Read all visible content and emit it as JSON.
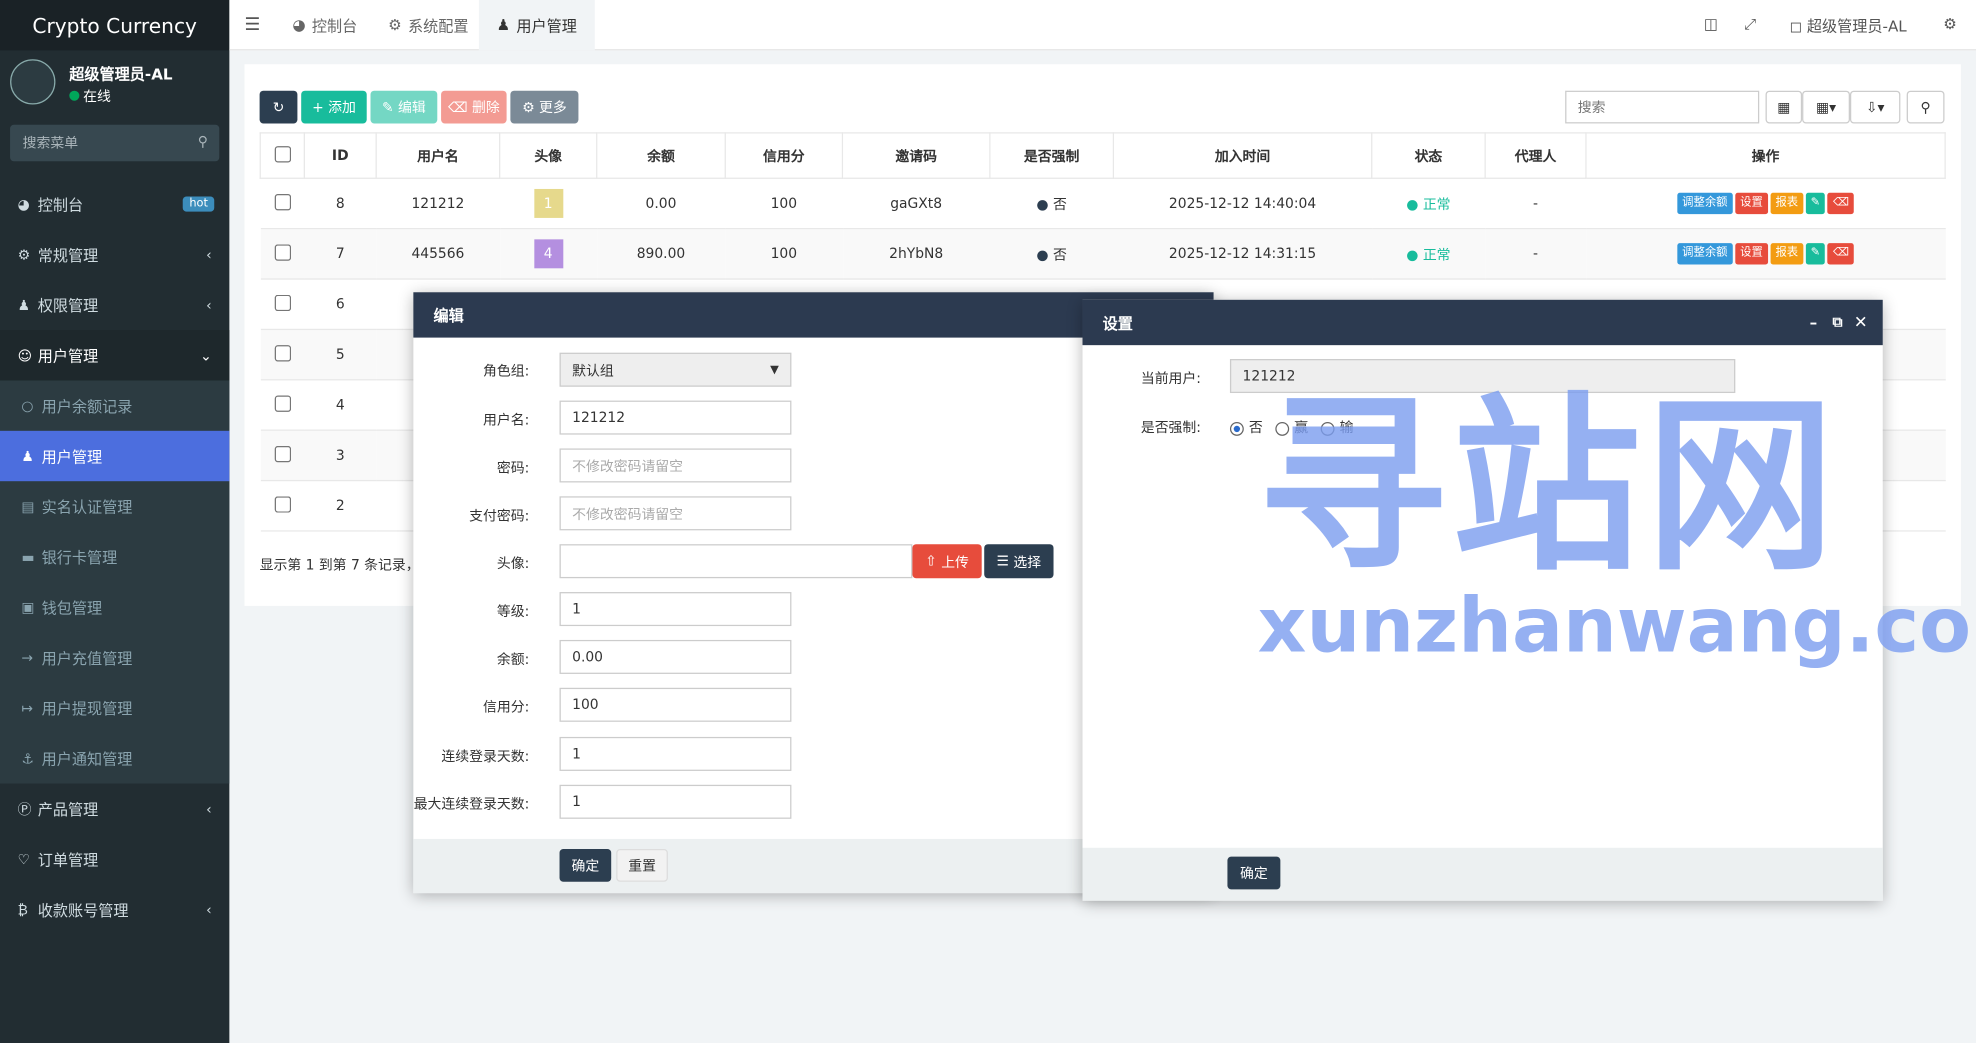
{
  "sidebar": {
    "logo": "Crypto Currency",
    "user": {
      "name": "超级管理员-AL",
      "status": "在线"
    },
    "search_placeholder": "搜索菜单",
    "menu": [
      {
        "label": "控制台",
        "icon": "dashboard-icon",
        "badge": "hot"
      },
      {
        "label": "常规管理",
        "icon": "cogs-icon"
      },
      {
        "label": "权限管理",
        "icon": "group-icon"
      },
      {
        "label": "用户管理",
        "icon": "user-circle-icon"
      },
      {
        "label": "产品管理",
        "icon": "product-icon"
      },
      {
        "label": "订单管理",
        "icon": "heartbeat-icon"
      },
      {
        "label": "收款账号管理",
        "icon": "bitcoin-icon"
      }
    ],
    "sub": [
      {
        "label": "用户余额记录",
        "icon": "circle-icon"
      },
      {
        "label": "用户管理",
        "icon": "user-icon"
      },
      {
        "label": "实名认证管理",
        "icon": "id-card-icon"
      },
      {
        "label": "银行卡管理",
        "icon": "credit-card-icon"
      },
      {
        "label": "钱包管理",
        "icon": "wallet-icon"
      },
      {
        "label": "用户充值管理",
        "icon": "sign-in-icon"
      },
      {
        "label": "用户提现管理",
        "icon": "sign-out-icon"
      },
      {
        "label": "用户通知管理",
        "icon": "anchor-icon"
      }
    ]
  },
  "topbar": {
    "tabs": [
      "控制台",
      "系统配置",
      "用户管理"
    ],
    "user": "超级管理员-AL"
  },
  "toolbar": {
    "add": "添加",
    "edit": "编辑",
    "delete": "删除",
    "more": "更多",
    "search_placeholder": "搜索"
  },
  "table": {
    "headers": [
      "ID",
      "用户名",
      "头像",
      "余额",
      "信用分",
      "邀请码",
      "是否强制",
      "加入时间",
      "状态",
      "代理人",
      "操作"
    ],
    "rows": [
      {
        "id": "8",
        "username": "121212",
        "avatar": "1",
        "avatar_color": "#e6d98c",
        "balance": "0.00",
        "credit": "100",
        "invite": "gaGXt8",
        "force": "否",
        "time": "2025-12-12 14:40:04",
        "status": "正常",
        "agent": "-"
      },
      {
        "id": "7",
        "username": "445566",
        "avatar": "4",
        "avatar_color": "#b48fe0",
        "balance": "890.00",
        "credit": "100",
        "invite": "2hYbN8",
        "force": "否",
        "time": "2025-12-12 14:31:15",
        "status": "正常",
        "agent": "-"
      },
      {
        "id": "6"
      },
      {
        "id": "5"
      },
      {
        "id": "4"
      },
      {
        "id": "3"
      },
      {
        "id": "2"
      }
    ],
    "ops": [
      "调整余额",
      "设置",
      "报表"
    ],
    "footer": "显示第 1 到第 7 条记录，"
  },
  "edit_modal": {
    "title": "编辑",
    "fields": [
      {
        "label": "角色组:",
        "value": "默认组"
      },
      {
        "label": "用户名:",
        "value": "121212"
      },
      {
        "label": "密码:",
        "placeholder": "不修改密码请留空"
      },
      {
        "label": "支付密码:",
        "placeholder": "不修改密码请留空"
      },
      {
        "label": "头像:",
        "value": ""
      },
      {
        "label": "等级:",
        "value": "1"
      },
      {
        "label": "余额:",
        "value": "0.00"
      },
      {
        "label": "信用分:",
        "value": "100"
      },
      {
        "label": "连续登录天数:",
        "value": "1"
      },
      {
        "label": "最大连续登录天数:",
        "value": "1"
      }
    ],
    "upload": "上传",
    "choose": "选择",
    "confirm": "确定",
    "reset": "重置"
  },
  "settings_modal": {
    "title": "设置",
    "current_user_label": "当前用户:",
    "current_user": "121212",
    "force_label": "是否强制:",
    "options": [
      "否",
      "赢",
      "输"
    ],
    "confirm": "确定"
  },
  "watermark": {
    "cn": "寻站网",
    "en": "xunzhanwang.com"
  }
}
